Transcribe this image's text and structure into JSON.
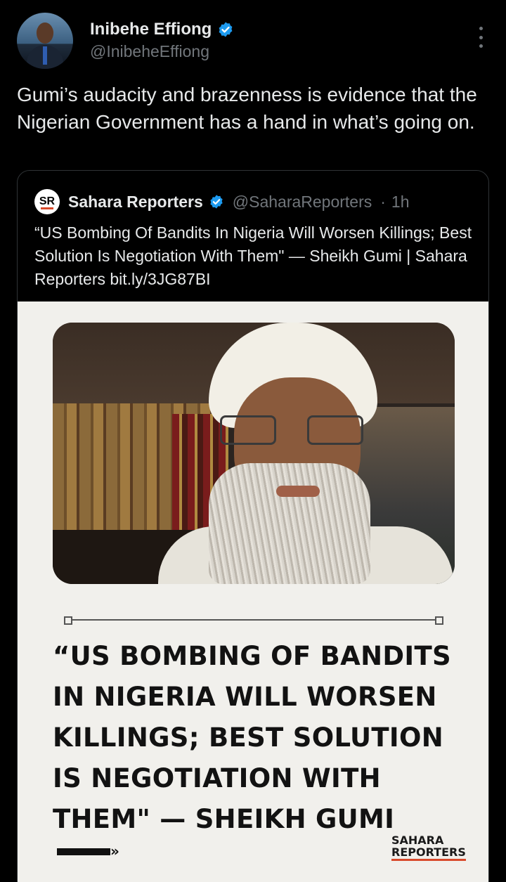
{
  "author": {
    "display_name": "Inibehe Effiong",
    "handle": "@InibeheEffiong",
    "verified_color": "#1d9bf0"
  },
  "tweet": {
    "text": "Gumi’s audacity and brazenness is evidence that the Nigerian Government has a hand in what’s going on."
  },
  "quoted": {
    "logo_text": "SR",
    "display_name": "Sahara Reporters",
    "handle": "@SaharaReporters",
    "separator": "·",
    "time": "1h",
    "text": "“US Bombing Of Bandits In Nigeria Will Worsen Killings; Best Solution Is Negotiation With Them\" — Sheikh Gumi | Sahara Reporters bit.ly/3JG87BI",
    "media": {
      "headline": "“US BOMBING OF BANDITS IN NIGERIA WILL WORSEN KILLINGS; BEST SOLUTION IS NEGOTIATION WITH THEM\" — SHEIKH GUMI",
      "arrow": "»",
      "brand_line1": "SAHARA",
      "brand_line2": "REPORTERS",
      "brand_accent": "#d94a2b"
    }
  },
  "icons": {
    "more": "more-vertical-icon",
    "verified": "verified-badge-icon"
  }
}
